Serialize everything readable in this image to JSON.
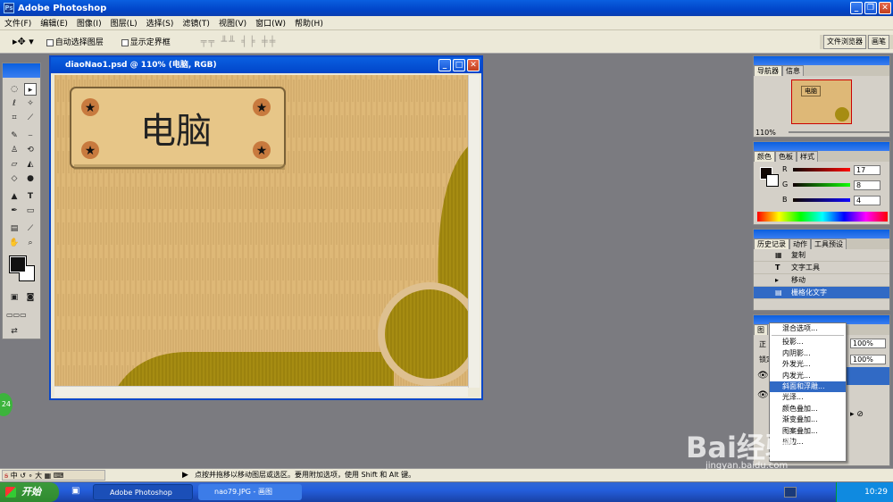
{
  "app": {
    "title": "Adobe Photoshop"
  },
  "menu": [
    "文件(F)",
    "编辑(E)",
    "图像(I)",
    "图层(L)",
    "选择(S)",
    "滤镜(T)",
    "视图(V)",
    "窗口(W)",
    "帮助(H)"
  ],
  "options": {
    "auto_select_label": "自动选择图层",
    "show_bounds_label": "显示定界框",
    "palette_well": [
      "文件浏览器",
      "画笔"
    ]
  },
  "document": {
    "title": "diaoNao1.psd @ 110% (电脑, RGB)",
    "sign_text": "电脑"
  },
  "navigator": {
    "tabs": [
      "导航器",
      "信息"
    ],
    "zoom": "110%",
    "thumb_text": "电脑"
  },
  "color": {
    "tabs": [
      "颜色",
      "色板",
      "样式"
    ],
    "r_label": "R",
    "g_label": "G",
    "b_label": "B",
    "r_value": "17",
    "g_value": "8",
    "b_value": "4"
  },
  "history": {
    "tabs": [
      "历史记录",
      "动作",
      "工具预设"
    ],
    "items": [
      "复制",
      "文字工具",
      "移动",
      "栅格化文字"
    ]
  },
  "layers": {
    "tab_label": "图",
    "mode_label": "正",
    "opacity": "100%",
    "lock_label": "锁定",
    "fill": "100%"
  },
  "context_menu": {
    "items": [
      "混合选项...",
      "投影...",
      "内阴影...",
      "外发光...",
      "内发光...",
      "斜面和浮雕...",
      "光泽...",
      "颜色叠加...",
      "渐变叠加...",
      "图案叠加...",
      "描边..."
    ]
  },
  "status": {
    "message": "点按并拖移以移动图层或选区。要用附加选项，使用 Shift 和 Alt 键。"
  },
  "ime": {
    "label": "中"
  },
  "taskbar": {
    "start": "开始",
    "buttons": [
      "Adobe Photoshop",
      "nao79.JPG - 画图"
    ],
    "clock": "10:29"
  },
  "badge": "24",
  "watermark": {
    "brand": "Bai经验",
    "url": "jingyan.baidu.com"
  },
  "colors": {
    "xp_blue": "#0a5fe0",
    "wood": "#deb877",
    "olive": "#a58c10",
    "selection": "#316ac5"
  }
}
